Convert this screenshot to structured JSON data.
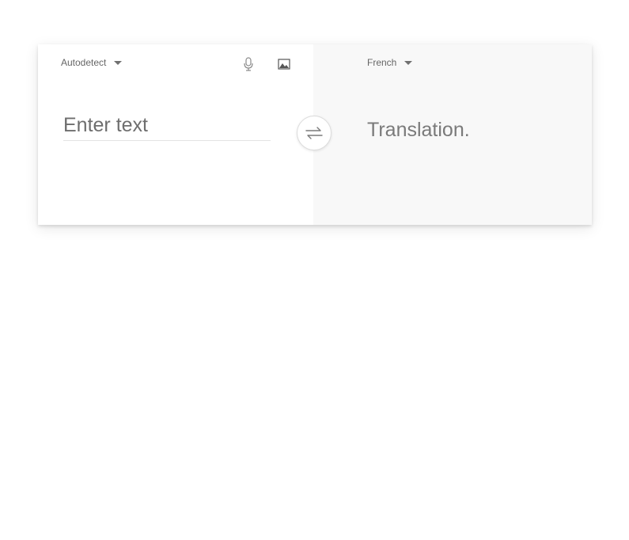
{
  "source": {
    "language_label": "Autodetect",
    "input_value": "",
    "input_placeholder": "Enter text",
    "icons": [
      "microphone-icon",
      "image-icon",
      "chevron-down-icon"
    ]
  },
  "target": {
    "language_label": "French",
    "translation_text": "Translation."
  },
  "swap": {
    "icon": "swap-arrows-icon"
  },
  "colors": {
    "left_background": "#ffffff",
    "right_background": "#f8f8f8",
    "text_muted": "#6d6d6d"
  }
}
